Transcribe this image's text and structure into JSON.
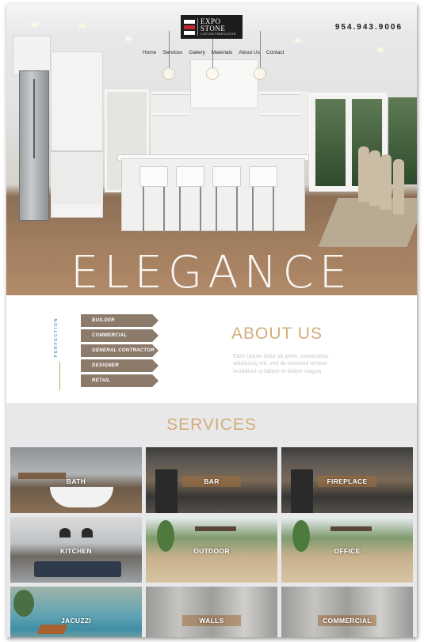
{
  "header": {
    "logo_main": "EXPO STONE",
    "logo_tagline": "CUSTOM FABRICATION",
    "phone": "954.943.9006",
    "nav": [
      "Home",
      "Services",
      "Gallery",
      "Materials",
      "About Us",
      "Contact"
    ]
  },
  "hero": {
    "title": "ELEGANCE"
  },
  "about": {
    "side_label": "PERFECTION",
    "tags": [
      "BUILDER",
      "COMMERCIAL",
      "GENERAL CONTRACTOR",
      "DESIGNER",
      "RETAIL"
    ],
    "title": "ABOUT US",
    "text": "Each ipsum dolor sit amet, consectetur adipiscing elit, sed do eiusmod tempor incididunt ut labore et dolore magna"
  },
  "services": {
    "title": "SERVICES",
    "tiles": [
      "BATH",
      "BAR",
      "FIREPLACE",
      "KITCHEN",
      "OUTDOOR",
      "OFFICE",
      "JACUZZI",
      "WALLS",
      "COMMERCIAL"
    ]
  },
  "colors": {
    "accent_gold": "#d4ac7a",
    "tag_bg": "#8c7a6b",
    "perfection_blue": "#6f9ab8",
    "logo_red": "#c8262b",
    "logo_white": "#ffffff"
  }
}
